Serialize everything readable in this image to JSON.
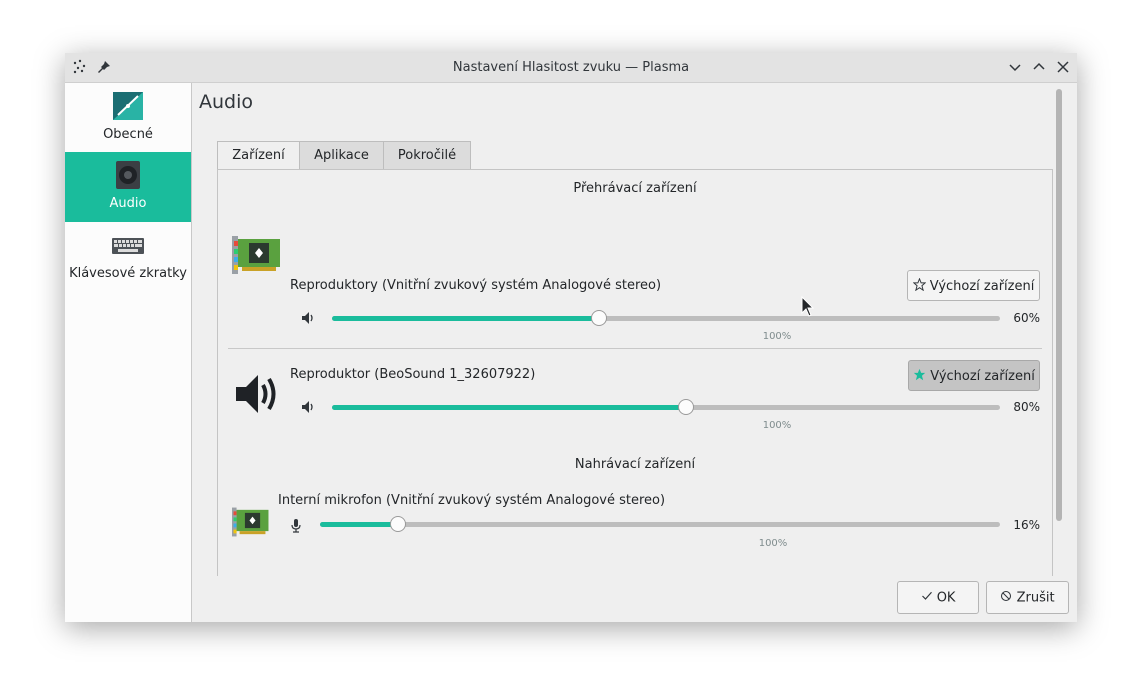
{
  "window": {
    "title": "Nastavení Hlasitost zvuku — Plasma"
  },
  "sidebar": {
    "items": [
      {
        "label": "Obecné",
        "active": false
      },
      {
        "label": "Audio",
        "active": true
      },
      {
        "label": "Klávesové zkratky",
        "active": false
      }
    ]
  },
  "page": {
    "title": "Audio"
  },
  "tabs": [
    {
      "label": "Zařízení"
    },
    {
      "label": "Aplikace"
    },
    {
      "label": "Pokročilé"
    }
  ],
  "playback": {
    "header": "Přehrávací zařízení",
    "devices": [
      {
        "name": "Reproduktory (Vnitřní zvukový systém Analogové stereo)",
        "volume_text": "60%",
        "volume": 0.4,
        "mark": "100%",
        "default_label": "Výchozí zařízení",
        "is_default": false
      },
      {
        "name": "Reproduktor (BeoSound 1_32607922)",
        "volume_text": "80%",
        "volume": 0.53,
        "mark": "100%",
        "default_label": "Výchozí zařízení",
        "is_default": true
      }
    ]
  },
  "recording": {
    "header": "Nahrávací zařízení",
    "devices": [
      {
        "name": "Interní mikrofon (Vnitřní zvukový systém Analogové stereo)",
        "volume_text": "16%",
        "volume": 0.115,
        "mark": "100%"
      }
    ]
  },
  "footer": {
    "ok_label": "OK",
    "cancel_label": "Zrušit"
  },
  "colors": {
    "accent": "#1abc9c",
    "track": "#bdbdbd"
  }
}
